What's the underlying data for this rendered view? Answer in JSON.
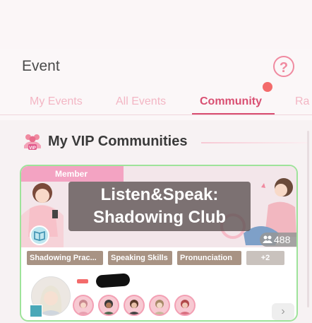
{
  "header": {
    "title": "Event",
    "help_icon": "question-icon"
  },
  "tabs": [
    {
      "label": "My Events"
    },
    {
      "label": "All Events"
    },
    {
      "label": "Community"
    },
    {
      "label": "Ra"
    }
  ],
  "active_tab": "Community",
  "section": {
    "title": "My VIP Communities",
    "icon": "vip-group-icon"
  },
  "community_card": {
    "member_label": "Member",
    "title_line1": "Listen&Speak:",
    "title_line2": "Shadowing Club",
    "member_count": "488",
    "tags": [
      "Shadowing Prac...",
      "Speaking Skills",
      "Pronunciation"
    ],
    "more_tags": "+2"
  },
  "colors": {
    "accent": "#d94f72",
    "card_border": "#9ee39a",
    "tag_bg": "#a89384"
  }
}
